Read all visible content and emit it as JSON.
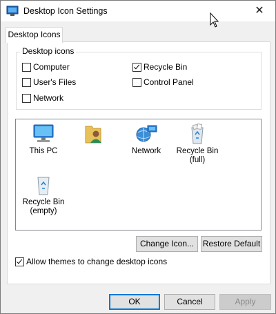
{
  "window": {
    "title": "Desktop Icon Settings",
    "close_glyph": "✕"
  },
  "tab": {
    "label": "Desktop Icons"
  },
  "group": {
    "legend": "Desktop icons",
    "items": [
      {
        "label": "Computer",
        "checked": false
      },
      {
        "label": "Recycle Bin",
        "checked": true
      },
      {
        "label": "User's Files",
        "checked": false
      },
      {
        "label": "Control Panel",
        "checked": false
      },
      {
        "label": "Network",
        "checked": false
      }
    ]
  },
  "icons": [
    {
      "name": "computer-icon",
      "label": "This PC"
    },
    {
      "name": "user-files-icon",
      "label": ""
    },
    {
      "name": "network-icon",
      "label": "Network"
    },
    {
      "name": "recycle-bin-full-icon",
      "label": "Recycle Bin\n(full)"
    },
    {
      "name": "recycle-bin-empty-icon",
      "label": "Recycle Bin\n(empty)"
    }
  ],
  "buttons": {
    "change_icon": "Change Icon...",
    "restore_default": "Restore Default",
    "ok": "OK",
    "cancel": "Cancel",
    "apply": "Apply"
  },
  "allow_themes": {
    "label": "Allow themes to change desktop icons",
    "checked": true
  }
}
